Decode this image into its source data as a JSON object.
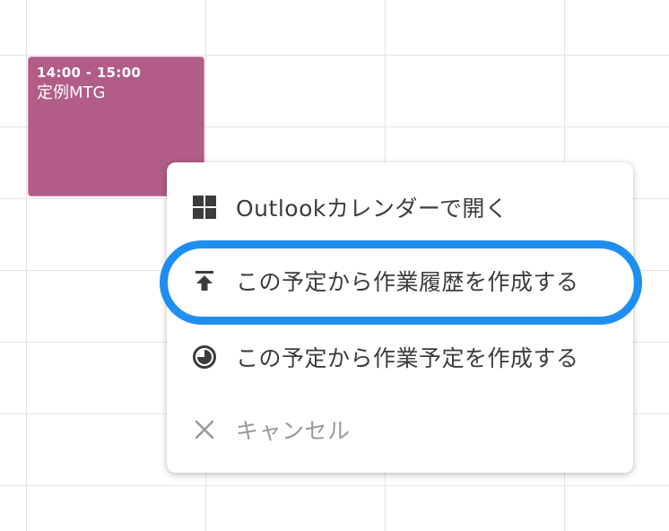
{
  "event": {
    "time": "14:00 - 15:00",
    "title": "定例MTG",
    "color": "#b15d87"
  },
  "menu": {
    "items": [
      {
        "label": "Outlookカレンダーで開く",
        "icon": "windows-grid-icon"
      },
      {
        "label": "この予定から作業履歴を作成する",
        "icon": "upload-arrow-icon",
        "highlighted": true
      },
      {
        "label": "この予定から作業予定を作成する",
        "icon": "clock-circle-icon"
      },
      {
        "label": "キャンセル",
        "icon": "close-icon"
      }
    ]
  },
  "colors": {
    "highlight": "#1e8ff0",
    "menu_text": "#3c3c3c",
    "cancel_text": "#9a9a9a",
    "grid_line": "#e3e3e3"
  }
}
